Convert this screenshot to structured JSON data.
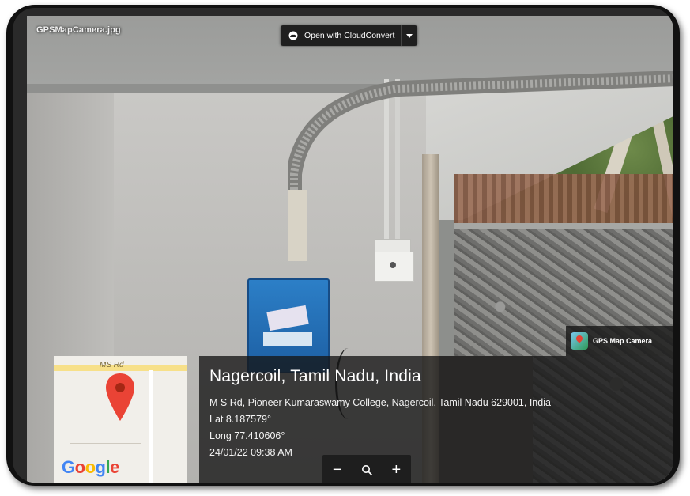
{
  "viewer": {
    "filename": "GPSMapCamera.jpg",
    "open_with_label": "Open with CloudConvert",
    "open_with_icon": "cloud-icon",
    "dropdown_icon": "chevron-down-icon"
  },
  "gps_overlay": {
    "badge_label": "GPS Map Camera",
    "map": {
      "road_label": "MS Rd",
      "logo_letters": [
        "G",
        "o",
        "o",
        "g",
        "l",
        "e"
      ]
    },
    "location_title": "Nagercoil, Tamil Nadu, India",
    "address": "M S Rd, Pioneer Kumaraswamy College, Nagercoil, Tamil Nadu 629001, India",
    "latitude": "Lat 8.187579°",
    "longitude": "Long 77.410606°",
    "datetime": "24/01/22 09:38 AM"
  },
  "zoom_controls": {
    "zoom_out_label": "−",
    "zoom_in_label": "+",
    "reset_icon": "search-icon"
  },
  "colors": {
    "dispenser_blue": "#2c7fc7",
    "map_pin_red": "#ea4335",
    "panel_bg": "#161616"
  }
}
